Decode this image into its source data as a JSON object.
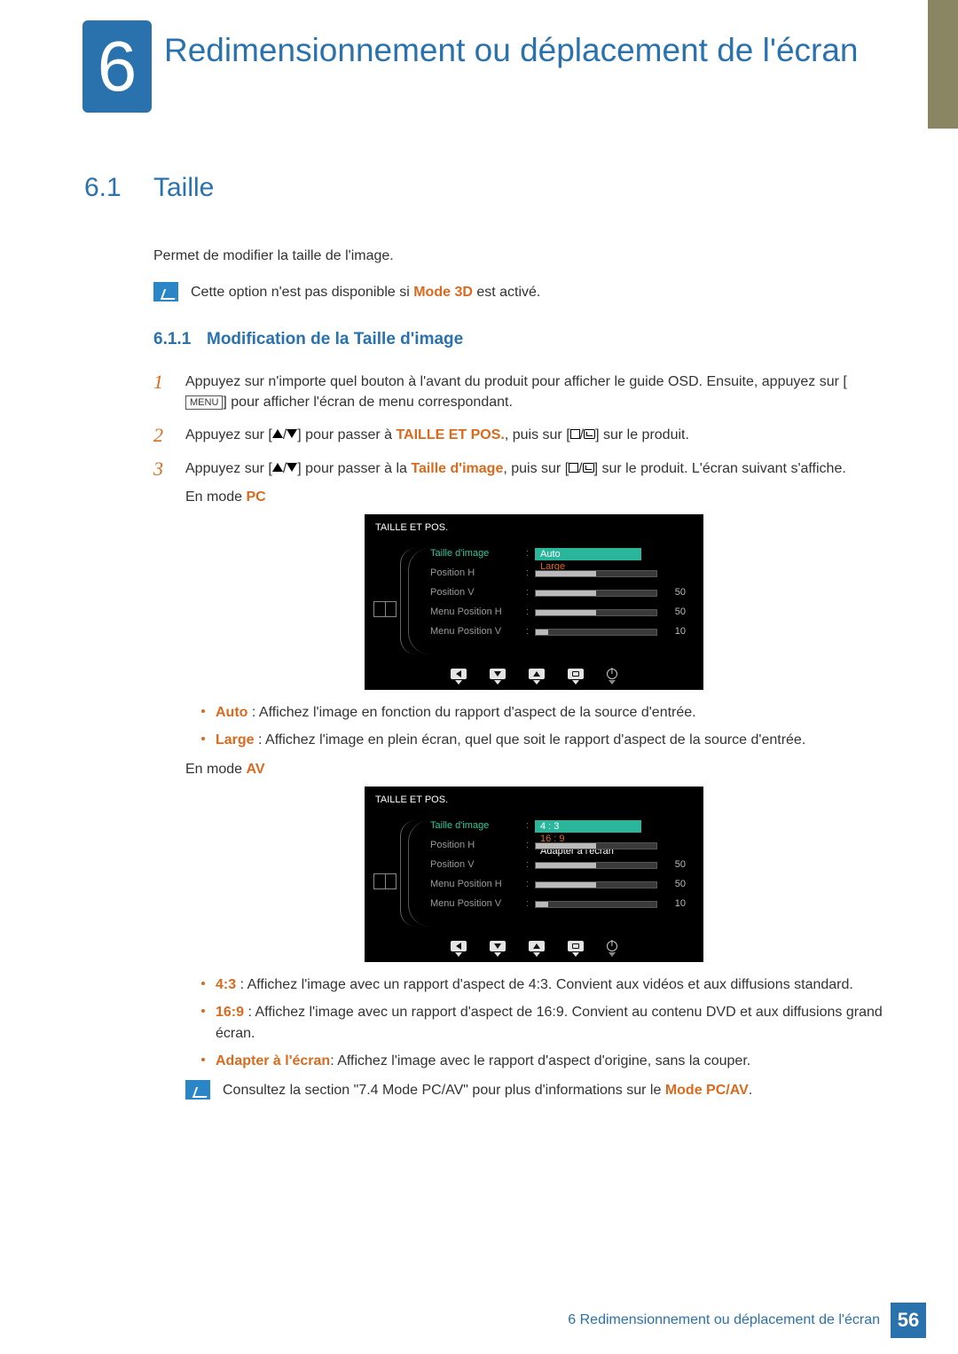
{
  "chapter": {
    "number": "6",
    "title": "Redimensionnement ou déplacement de l'écran"
  },
  "section": {
    "number": "6.1",
    "title": "Taille"
  },
  "intro": "Permet de modifier la taille de l'image.",
  "note1": {
    "pre": "Cette option n'est pas disponible si ",
    "hl": "Mode 3D",
    "post": " est activé."
  },
  "subsection": {
    "number": "6.1.1",
    "title": "Modification de la Taille d'image"
  },
  "steps": {
    "s1": {
      "num": "1",
      "a": "Appuyez sur n'importe quel bouton à l'avant du produit pour afficher le guide OSD. Ensuite, appuyez sur [",
      "menu": "MENU",
      "b": "] pour afficher l'écran de menu correspondant."
    },
    "s2": {
      "num": "2",
      "a": "Appuyez sur [",
      "b": "] pour passer à ",
      "hl": "TAILLE ET POS.",
      "c": ", puis sur [",
      "d": "] sur le produit."
    },
    "s3": {
      "num": "3",
      "a": "Appuyez sur [",
      "b": "] pour passer à la ",
      "hl": "Taille d'image",
      "c": ", puis sur [",
      "d": "] sur le produit. L'écran suivant s'affiche."
    }
  },
  "mode_pc": {
    "pre": "En mode ",
    "hl": "PC"
  },
  "mode_av": {
    "pre": "En mode ",
    "hl": "AV"
  },
  "osd_pc": {
    "title": "TAILLE ET POS.",
    "rows": [
      {
        "label": "Taille d'image",
        "active": true,
        "options": [
          "Auto",
          "Large"
        ],
        "selected": 1
      },
      {
        "label": "Position H",
        "fill": 50,
        "val": ""
      },
      {
        "label": "Position V",
        "fill": 50,
        "val": "50"
      },
      {
        "label": "Menu Position H",
        "fill": 50,
        "val": "50"
      },
      {
        "label": "Menu Position V",
        "fill": 10,
        "val": "10"
      }
    ]
  },
  "osd_av": {
    "title": "TAILLE ET POS.",
    "rows": [
      {
        "label": "Taille d'image",
        "active": true,
        "options": [
          "4 : 3",
          "16 : 9",
          "Adapter à l'écran"
        ],
        "selected": 1
      },
      {
        "label": "Position H",
        "fill": 50,
        "val": ""
      },
      {
        "label": "Position V",
        "fill": 50,
        "val": "50"
      },
      {
        "label": "Menu Position H",
        "fill": 50,
        "val": "50"
      },
      {
        "label": "Menu Position V",
        "fill": 10,
        "val": "10"
      }
    ]
  },
  "bullets_pc": {
    "b1": {
      "hl": "Auto",
      "text": " : Affichez l'image en fonction du rapport d'aspect de la source d'entrée."
    },
    "b2": {
      "hl": "Large",
      "text": " : Affichez l'image en plein écran, quel que soit le rapport d'aspect de la source d'entrée."
    }
  },
  "bullets_av": {
    "b1": {
      "hl": "4:3",
      "text": " : Affichez l'image avec un rapport d'aspect de 4:3. Convient aux vidéos et aux diffusions standard."
    },
    "b2": {
      "hl": "16:9",
      "text": " : Affichez l'image avec un rapport d'aspect de 16:9. Convient au contenu DVD et aux diffusions grand écran."
    },
    "b3": {
      "hl": "Adapter à l'écran",
      "text": ": Affichez l'image avec le rapport d'aspect d'origine, sans la couper."
    }
  },
  "note2": {
    "a": "Consultez la section \"7.4 Mode PC/AV\" pour plus d'informations sur le ",
    "hl": "Mode PC/AV",
    "b": "."
  },
  "footer": {
    "text": "6 Redimensionnement ou déplacement de l'écran",
    "page": "56"
  }
}
